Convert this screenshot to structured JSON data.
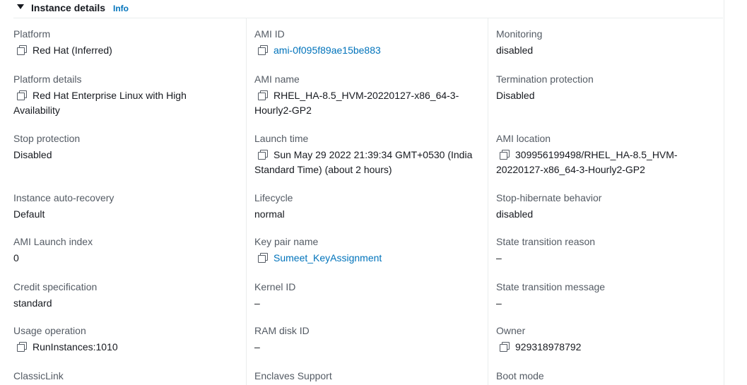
{
  "header": {
    "title": "Instance details",
    "info": "Info"
  },
  "col1": {
    "platform": {
      "label": "Platform",
      "value": "Red Hat (Inferred)"
    },
    "platform_details": {
      "label": "Platform details",
      "value_line1": "Red Hat Enterprise Linux with High",
      "value_line2": "Availability"
    },
    "stop_protection": {
      "label": "Stop protection",
      "value": "Disabled"
    },
    "auto_recovery": {
      "label": "Instance auto-recovery",
      "value": "Default"
    },
    "ami_launch_index": {
      "label": "AMI Launch index",
      "value": "0"
    },
    "credit_spec": {
      "label": "Credit specification",
      "value": "standard"
    },
    "usage_operation": {
      "label": "Usage operation",
      "value": "RunInstances:1010"
    },
    "classiclink": {
      "label": "ClassicLink"
    }
  },
  "col2": {
    "ami_id": {
      "label": "AMI ID",
      "value": "ami-0f095f89ae15be883"
    },
    "ami_name": {
      "label": "AMI name",
      "value_line1": "RHEL_HA-8.5_HVM-20220127-x86_64-3-",
      "value_line2": "Hourly2-GP2"
    },
    "launch_time": {
      "label": "Launch time",
      "value_line1": "Sun May 29 2022 21:39:34 GMT+0530 (India",
      "value_line2": "Standard Time) (about 2 hours)"
    },
    "lifecycle": {
      "label": "Lifecycle",
      "value": "normal"
    },
    "key_pair": {
      "label": "Key pair name",
      "value": "Sumeet_KeyAssignment"
    },
    "kernel_id": {
      "label": "Kernel ID",
      "value": "–"
    },
    "ram_disk_id": {
      "label": "RAM disk ID",
      "value": "–"
    },
    "enclaves": {
      "label": "Enclaves Support"
    }
  },
  "col3": {
    "monitoring": {
      "label": "Monitoring",
      "value": "disabled"
    },
    "termination_protection": {
      "label": "Termination protection",
      "value": "Disabled"
    },
    "ami_location": {
      "label": "AMI location",
      "value_line1": "309956199498/RHEL_HA-8.5_HVM-",
      "value_line2": "20220127-x86_64-3-Hourly2-GP2"
    },
    "stop_hibernate": {
      "label": "Stop-hibernate behavior",
      "value": "disabled"
    },
    "state_transition_reason": {
      "label": "State transition reason",
      "value": "–"
    },
    "state_transition_message": {
      "label": "State transition message",
      "value": "–"
    },
    "owner": {
      "label": "Owner",
      "value": "929318978792"
    },
    "boot_mode": {
      "label": "Boot mode"
    }
  }
}
